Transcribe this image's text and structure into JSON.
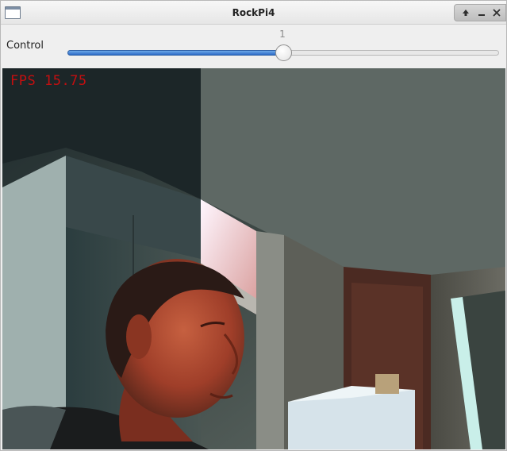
{
  "window": {
    "title": "RockPi4",
    "icons": {
      "app": "window-icon",
      "up": "arrow-up-icon",
      "minimize": "minimize-icon",
      "close": "close-icon"
    }
  },
  "toolbar": {
    "control_label": "Control",
    "slider_value": "1"
  },
  "slider": {
    "min": 0,
    "max": 2,
    "value": 1,
    "fill_fraction": 0.5,
    "accent": "#2d6bc7"
  },
  "camera": {
    "fps_label": "FPS",
    "fps_value": "15.75",
    "overlay_color": "#c30f10"
  }
}
